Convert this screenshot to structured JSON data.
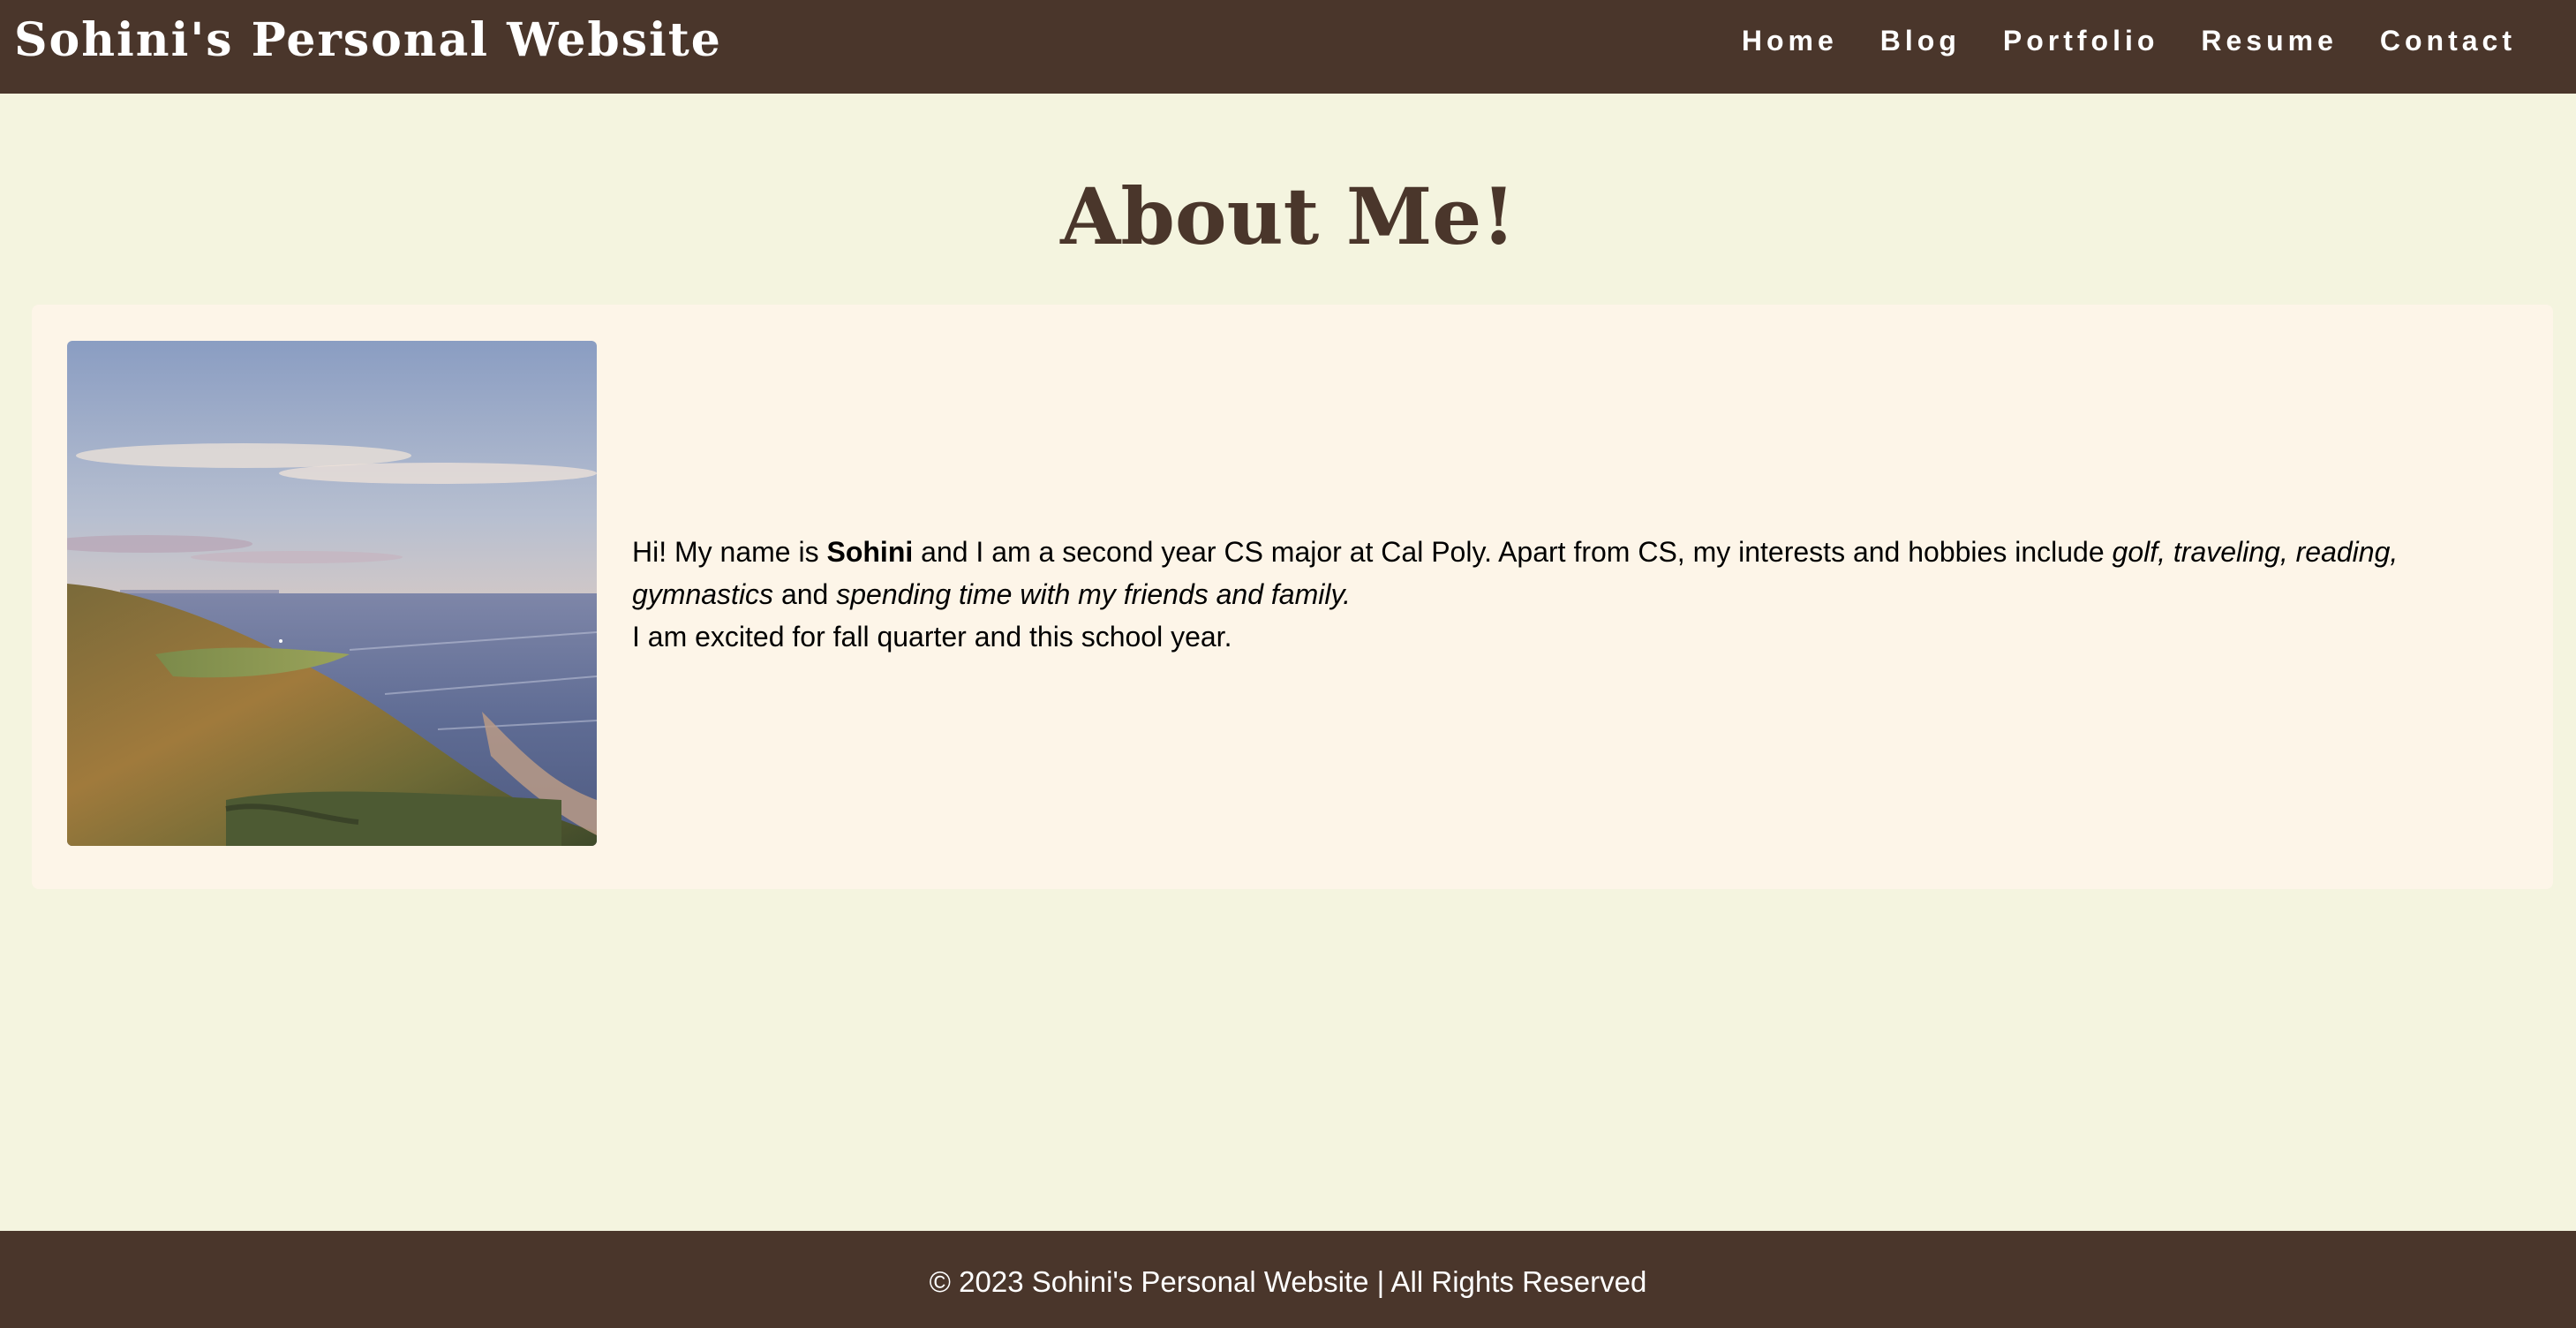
{
  "header": {
    "site_title": "Sohini's Personal Website",
    "nav": [
      "Home",
      "Blog",
      "Portfolio",
      "Resume",
      "Contact"
    ]
  },
  "main": {
    "heading": "About Me!",
    "photo": "golf course on a coastal cliff at sunset",
    "intro": {
      "greeting": "Hi! My name is ",
      "name": "Sohini",
      "after_name": " and I am a second year CS major at Cal Poly. Apart from CS, my interests and hobbies include ",
      "hobbies": "golf, traveling, reading, gymnastics",
      "connector": " and ",
      "hobby_last": "spending time with my friends and family.",
      "line2": "I am excited for fall quarter and this school year."
    }
  },
  "footer": {
    "text": "© 2023 Sohini's Personal Website | All Rights Reserved"
  },
  "colors": {
    "brand_brown": "#4a362b",
    "page_background": "#f4f4df",
    "card_background": "#fdf5e8"
  }
}
